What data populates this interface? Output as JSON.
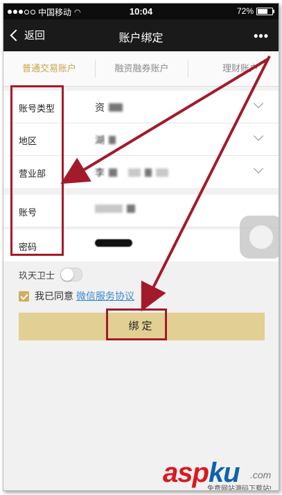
{
  "status_bar": {
    "carrier": "中国移动",
    "time": "10:04",
    "battery": "72%",
    "battery_level": 0.72
  },
  "nav": {
    "back_label": "返回",
    "title": "账户绑定",
    "more_label": "•••"
  },
  "tabs": [
    {
      "label": "普通交易账户",
      "active": true
    },
    {
      "label": "融资融券账户",
      "active": false
    },
    {
      "label": "理财账户",
      "active": false
    }
  ],
  "form": {
    "account_type": {
      "label": "账号类型",
      "value": "资"
    },
    "region": {
      "label": "地区",
      "value": "湖"
    },
    "branch": {
      "label": "营业部",
      "value": "李"
    },
    "account": {
      "label": "账号",
      "value": ""
    },
    "password": {
      "label": "密码",
      "value": ""
    }
  },
  "guard": {
    "label": "玖天卫士",
    "enabled": false
  },
  "agreement": {
    "checked": true,
    "prefix": "我已同意",
    "link_label": "微信服务协议"
  },
  "bind_button": {
    "label": "绑定"
  },
  "watermark": {
    "brand_a": "asp",
    "brand_b": "ku",
    "suffix": ".com",
    "tagline": "免费网站源码下载站!"
  },
  "colors": {
    "accent_gold": "#c9a34b",
    "button_bg": "#e2cf93",
    "highlight_red": "#a31a2a",
    "link_blue": "#3a8ad3"
  }
}
